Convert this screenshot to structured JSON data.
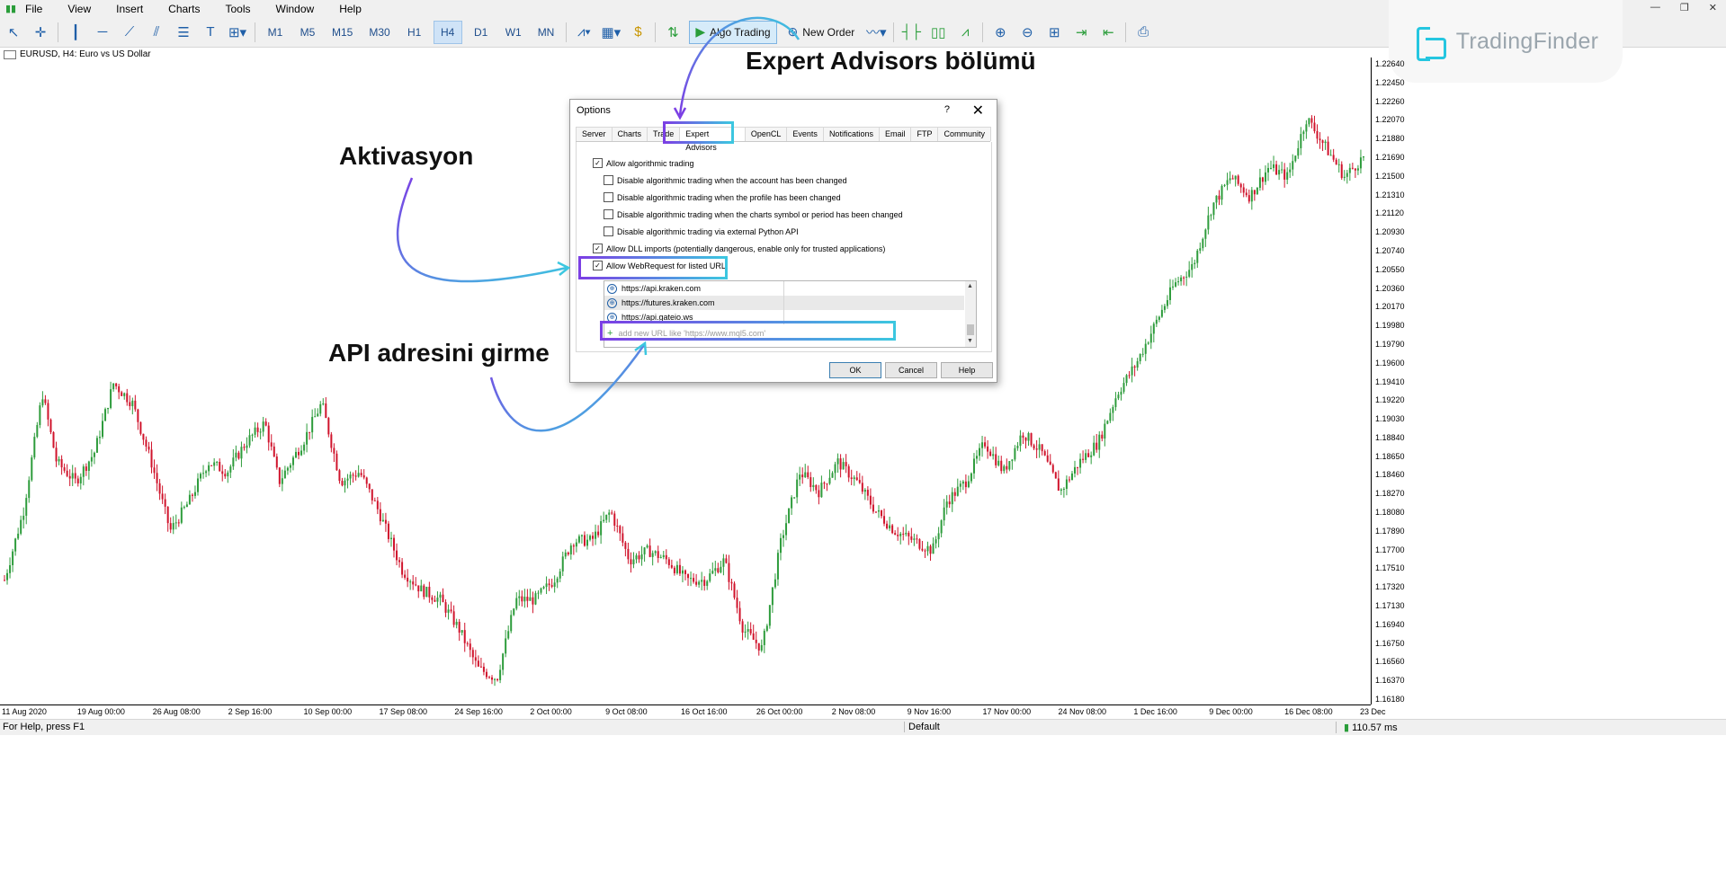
{
  "menu": {
    "items": [
      "File",
      "View",
      "Insert",
      "Charts",
      "Tools",
      "Window",
      "Help"
    ]
  },
  "toolbar": {
    "timeframes": [
      "M1",
      "M5",
      "M15",
      "M30",
      "H1",
      "H4",
      "D1",
      "W1",
      "MN"
    ],
    "active_timeframe": "H4",
    "algo_trading": "Algo Trading",
    "new_order": "New Order"
  },
  "logo": {
    "name": "TradingFinder"
  },
  "chart": {
    "label": "EURUSD, H4:  Euro vs US Dollar"
  },
  "chart_data": {
    "type": "candlestick",
    "symbol": "EURUSD",
    "timeframe": "H4",
    "y_ticks": [
      "1.22640",
      "1.22450",
      "1.22260",
      "1.22070",
      "1.21880",
      "1.21690",
      "1.21500",
      "1.21310",
      "1.21120",
      "1.20930",
      "1.20740",
      "1.20550",
      "1.20360",
      "1.20170",
      "1.19980",
      "1.19790",
      "1.19600",
      "1.19410",
      "1.19220",
      "1.19030",
      "1.18840",
      "1.18650",
      "1.18460",
      "1.18270",
      "1.18080",
      "1.17890",
      "1.17700",
      "1.17510",
      "1.17320",
      "1.17130",
      "1.16940",
      "1.16750",
      "1.16560",
      "1.16370",
      "1.16180"
    ],
    "x_ticks": [
      "11 Aug 2020",
      "19 Aug 00:00",
      "26 Aug 08:00",
      "2 Sep 16:00",
      "10 Sep 00:00",
      "17 Sep 08:00",
      "24 Sep 16:00",
      "2 Oct 00:00",
      "9 Oct 08:00",
      "16 Oct 16:00",
      "26 Oct 00:00",
      "2 Nov 08:00",
      "9 Nov 16:00",
      "17 Nov 00:00",
      "24 Nov 08:00",
      "1 Dec 16:00",
      "9 Dec 00:00",
      "16 Dec 08:00",
      "23 Dec"
    ],
    "path_points": [
      [
        0,
        1.174
      ],
      [
        4,
        1.181
      ],
      [
        8,
        1.193
      ],
      [
        11,
        1.186
      ],
      [
        15,
        1.184
      ],
      [
        19,
        1.187
      ],
      [
        23,
        1.194
      ],
      [
        27,
        1.192
      ],
      [
        31,
        1.186
      ],
      [
        35,
        1.179
      ],
      [
        39,
        1.182
      ],
      [
        43,
        1.186
      ],
      [
        47,
        1.185
      ],
      [
        51,
        1.188
      ],
      [
        55,
        1.19
      ],
      [
        58,
        1.184
      ],
      [
        63,
        1.188
      ],
      [
        67,
        1.192
      ],
      [
        71,
        1.184
      ],
      [
        75,
        1.185
      ],
      [
        79,
        1.181
      ],
      [
        84,
        1.175
      ],
      [
        88,
        1.173
      ],
      [
        92,
        1.172
      ],
      [
        96,
        1.169
      ],
      [
        100,
        1.165
      ],
      [
        104,
        1.164
      ],
      [
        108,
        1.172
      ],
      [
        112,
        1.172
      ],
      [
        116,
        1.174
      ],
      [
        120,
        1.178
      ],
      [
        124,
        1.178
      ],
      [
        128,
        1.181
      ],
      [
        132,
        1.176
      ],
      [
        136,
        1.177
      ],
      [
        140,
        1.176
      ],
      [
        144,
        1.174
      ],
      [
        148,
        1.174
      ],
      [
        152,
        1.176
      ],
      [
        156,
        1.169
      ],
      [
        160,
        1.167
      ],
      [
        164,
        1.178
      ],
      [
        168,
        1.185
      ],
      [
        172,
        1.183
      ],
      [
        176,
        1.186
      ],
      [
        180,
        1.184
      ],
      [
        184,
        1.181
      ],
      [
        188,
        1.179
      ],
      [
        192,
        1.178
      ],
      [
        196,
        1.177
      ],
      [
        199,
        1.182
      ],
      [
        203,
        1.184
      ],
      [
        207,
        1.188
      ],
      [
        211,
        1.185
      ],
      [
        215,
        1.189
      ],
      [
        219,
        1.187
      ],
      [
        223,
        1.183
      ],
      [
        227,
        1.186
      ],
      [
        231,
        1.188
      ],
      [
        235,
        1.193
      ],
      [
        239,
        1.196
      ],
      [
        243,
        1.2
      ],
      [
        247,
        1.204
      ],
      [
        251,
        1.206
      ],
      [
        255,
        1.212
      ],
      [
        259,
        1.215
      ],
      [
        263,
        1.213
      ],
      [
        267,
        1.216
      ],
      [
        271,
        1.215
      ],
      [
        275,
        1.221
      ],
      [
        279,
        1.218
      ],
      [
        283,
        1.215
      ],
      [
        287,
        1.217
      ]
    ],
    "path_x_unit": "trading-day index"
  },
  "dialog": {
    "title": "Options",
    "help_glyph": "?",
    "close_glyph": "✕",
    "tabs": [
      "Server",
      "Charts",
      "Trade",
      "Expert Advisors",
      "OpenCL",
      "Events",
      "Notifications",
      "Email",
      "FTP",
      "Community"
    ],
    "active_tab": "Expert Advisors",
    "options": [
      {
        "label": "Allow algorithmic trading",
        "checked": true
      },
      {
        "label": "Disable algorithmic trading when the account has been changed",
        "checked": false
      },
      {
        "label": "Disable algorithmic trading when the profile has been changed",
        "checked": false
      },
      {
        "label": "Disable algorithmic trading when the charts symbol or period has been changed",
        "checked": false
      },
      {
        "label": "Disable algorithmic trading via external Python API",
        "checked": false
      },
      {
        "label": "Allow DLL imports (potentially dangerous, enable only for trusted applications)",
        "checked": true
      },
      {
        "label": "Allow WebRequest for listed URL:",
        "checked": true
      }
    ],
    "urls": [
      "https://api.kraken.com",
      "https://futures.kraken.com",
      "https://api.gateio.ws"
    ],
    "add_url_placeholder": "add new URL like 'https://www.mql5.com'",
    "buttons": {
      "ok": "OK",
      "cancel": "Cancel",
      "help": "Help"
    }
  },
  "annotations": {
    "expert_advisors": "Expert Advisors bölümü",
    "activation": "Aktivasyon",
    "api_address": "API adresini girme"
  },
  "status": {
    "help_text": "For Help, press F1",
    "profile": "Default",
    "ping": "110.57 ms"
  },
  "colors": {
    "bull": "#2e9c3c",
    "bear": "#d0142c",
    "highlight_start": "#7b3fe4",
    "highlight_end": "#3cc7e0"
  }
}
